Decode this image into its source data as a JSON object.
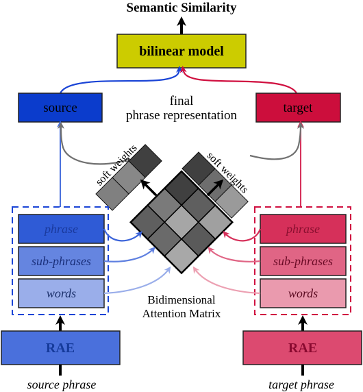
{
  "title": "Semantic Similarity",
  "bilinear": {
    "label": "bilinear model",
    "color": "#cccc00"
  },
  "final_repr": {
    "line1": "final",
    "line2": "phrase representation"
  },
  "source": {
    "label": "source",
    "color": "#0b3ccc",
    "arrow_color": "#1a44d6",
    "group_border": "#1a44d6",
    "items": [
      {
        "label": "phrase",
        "color": "#2f5bd6",
        "text_color": "#1a3a9e",
        "arrow_color": "#3a63d9"
      },
      {
        "label": "sub-phrases",
        "color": "#6585e0",
        "text_color": "#1a2f7a",
        "arrow_color": "#5f80e0"
      },
      {
        "label": "words",
        "color": "#9aaeea",
        "text_color": "#1a2f6a",
        "arrow_color": "#9aaeea"
      }
    ],
    "rae": {
      "label": "RAE",
      "color": "#4a70dc",
      "text_color": "#153a9a"
    },
    "input_label": "source phrase"
  },
  "target": {
    "label": "target",
    "color": "#cc0e3c",
    "arrow_color": "#d01040",
    "group_border": "#d01040",
    "items": [
      {
        "label": "phrase",
        "color": "#d6305a",
        "text_color": "#8a1030",
        "arrow_color": "#d6305a"
      },
      {
        "label": "sub-phrases",
        "color": "#e06585",
        "text_color": "#6a0a25",
        "arrow_color": "#e06585"
      },
      {
        "label": "words",
        "color": "#ea9aae",
        "text_color": "#5a0a20",
        "arrow_color": "#eca0b2"
      }
    ],
    "rae": {
      "label": "RAE",
      "color": "#dc4a70",
      "text_color": "#8a0a30"
    },
    "input_label": "target phrase"
  },
  "soft_weights": {
    "label": "soft weights",
    "left_shades": [
      "#808080",
      "#888888",
      "#404040"
    ],
    "right_shades": [
      "#404040",
      "#6e6e6e",
      "#9a9a9a"
    ]
  },
  "matrix": {
    "label_line1": "Bidimensional",
    "label_line2": "Attention Matrix",
    "rows": [
      [
        "#404040",
        "#5f5f5f",
        "#a0a0a0"
      ],
      [
        "#7a7a7a",
        "#a6a6a6",
        "#5a5a5a"
      ],
      [
        "#5f5f5f",
        "#6a6a6a",
        "#a8a8a8"
      ]
    ]
  },
  "connector_gray": "#707070"
}
